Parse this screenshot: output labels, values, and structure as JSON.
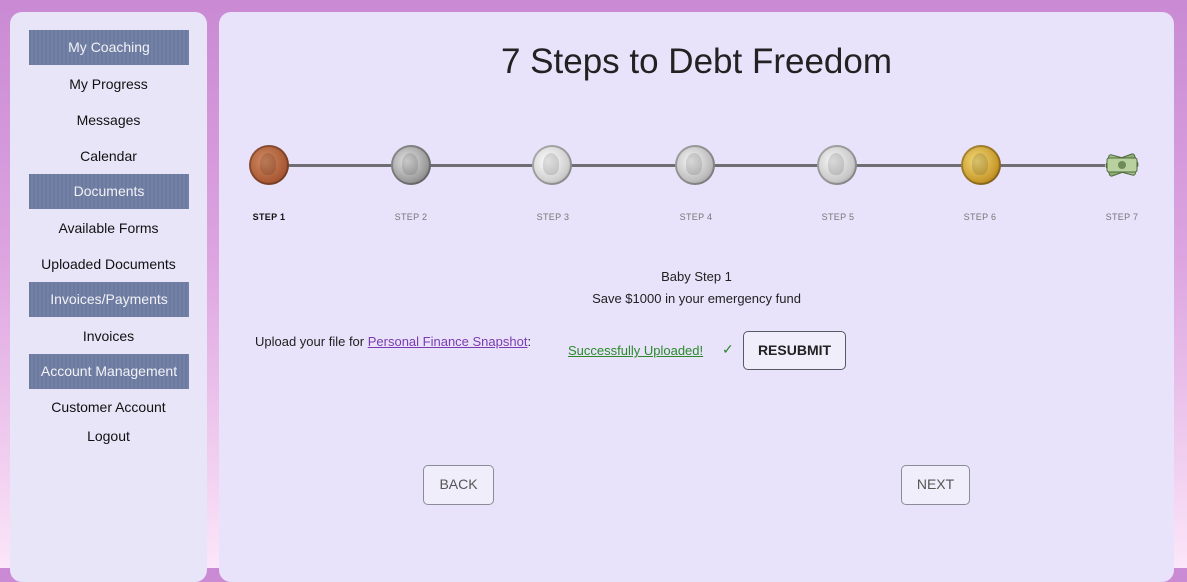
{
  "sidebar": {
    "items": [
      {
        "label": "My Coaching",
        "type": "header"
      },
      {
        "label": "My Progress",
        "type": "link"
      },
      {
        "label": "Messages",
        "type": "link"
      },
      {
        "label": "Calendar",
        "type": "link"
      },
      {
        "label": "Documents",
        "type": "header"
      },
      {
        "label": "Available Forms",
        "type": "link"
      },
      {
        "label": "Uploaded Documents",
        "type": "link"
      },
      {
        "label": "Invoices/Payments",
        "type": "header"
      },
      {
        "label": "Invoices",
        "type": "link"
      },
      {
        "label": "Account Management",
        "type": "header"
      },
      {
        "label": "Customer Account",
        "type": "link"
      },
      {
        "label": "Logout",
        "type": "link"
      }
    ]
  },
  "main": {
    "title": "7 Steps to Debt Freedom",
    "steps": [
      {
        "label": "STEP 1",
        "icon": "penny-coin-icon",
        "active": true
      },
      {
        "label": "STEP 2",
        "icon": "nickel-coin-icon",
        "active": false
      },
      {
        "label": "STEP 3",
        "icon": "dime-coin-icon",
        "active": false
      },
      {
        "label": "STEP 4",
        "icon": "quarter-coin-icon",
        "active": false
      },
      {
        "label": "STEP 5",
        "icon": "half-dollar-coin-icon",
        "active": false
      },
      {
        "label": "STEP 6",
        "icon": "gold-dollar-coin-icon",
        "active": false
      },
      {
        "label": "STEP 7",
        "icon": "cash-bills-icon",
        "active": false
      }
    ],
    "step_title": "Baby Step 1",
    "step_description": "Save $1000 in your emergency fund",
    "upload_prefix": "Upload your file for ",
    "upload_link": "Personal Finance Snapshot",
    "upload_suffix": ":",
    "upload_status": "Successfully Uploaded!",
    "upload_check": "✓",
    "resubmit_label": "RESUBMIT",
    "back_label": "BACK",
    "next_label": "NEXT"
  },
  "colors": {
    "nav_header_bg": "#6c7aa0",
    "panel_bg": "#e8e3fa",
    "link": "#7b3bb0",
    "success": "#2a8a2a"
  }
}
